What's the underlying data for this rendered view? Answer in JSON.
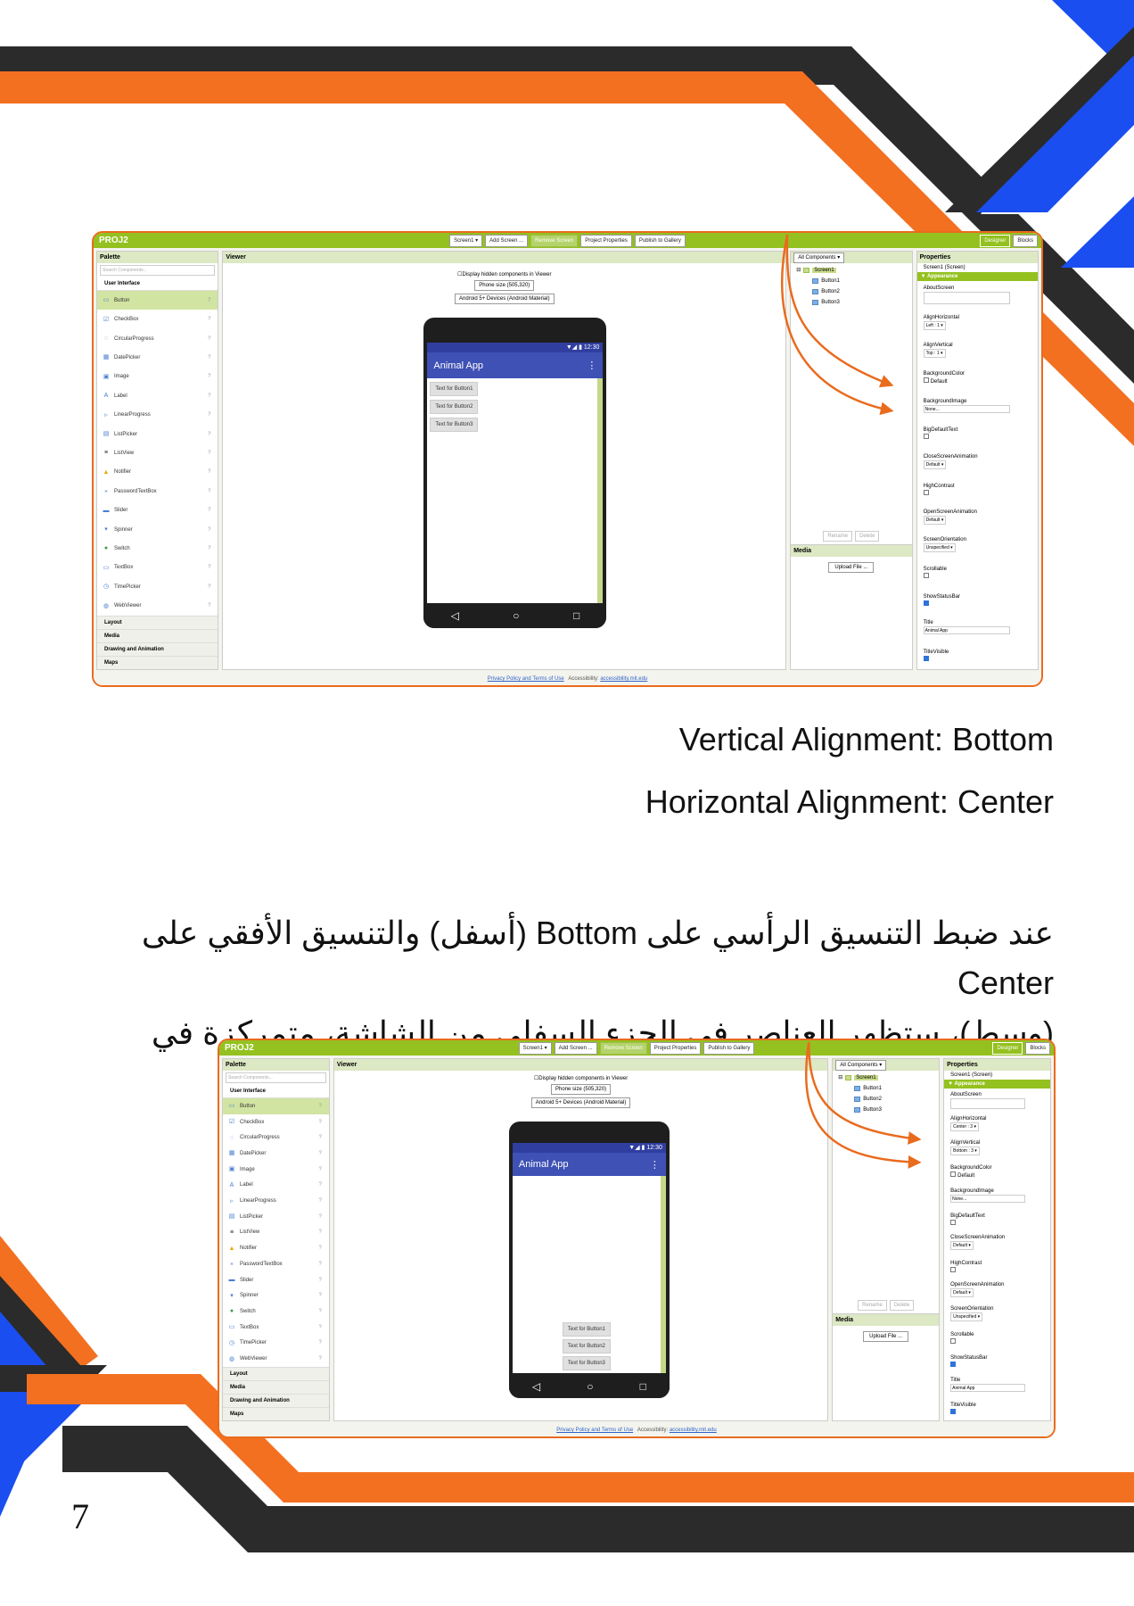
{
  "screenshots": [
    {
      "project": "PROJ2",
      "toolbar": {
        "screen": "Screen1 ▾",
        "add": "Add Screen ...",
        "remove": "Remove Screen",
        "props": "Project Properties",
        "publish": "Publish to Gallery",
        "designer": "Designer",
        "blocks": "Blocks"
      },
      "palette": {
        "title": "Palette",
        "search": "Search Components...",
        "section": "User Interface",
        "items": [
          "Button",
          "CheckBox",
          "CircularProgress",
          "DatePicker",
          "Image",
          "Label",
          "LinearProgress",
          "ListPicker",
          "ListView",
          "Notifier",
          "PasswordTextBox",
          "Slider",
          "Spinner",
          "Switch",
          "TextBox",
          "TimePicker",
          "WebViewer"
        ],
        "categories": [
          "Layout",
          "Media",
          "Drawing and Animation",
          "Maps"
        ]
      },
      "viewer": {
        "title": "Viewer",
        "checkbox": "Display hidden components in Viewer",
        "size": "Phone size (505,320)",
        "theme": "Android 5+ Devices (Android Material)"
      },
      "phone": {
        "time": "12:30",
        "app_title": "Animal App",
        "buttons": [
          "Text for Button1",
          "Text for Button2",
          "Text for Button3"
        ]
      },
      "components": {
        "title": "All Components ▾",
        "screen": "Screen1",
        "items": [
          "Button1",
          "Button2",
          "Button3"
        ],
        "rename": "Rename",
        "delete": "Delete"
      },
      "media": {
        "title": "Media",
        "upload": "Upload File ..."
      },
      "properties": {
        "title": "Properties",
        "subtitle": "Screen1 (Screen)",
        "group": "▼ Appearance",
        "align_h": "Left : 1 ▾",
        "align_v": "Top : 1 ▾",
        "bg_color": "Default",
        "bg_image": "None...",
        "close_anim": "Default ▾",
        "open_anim": "Default ▾",
        "orientation": "Unspecified ▾",
        "title_value": "Animal App"
      },
      "footer": {
        "link": "Privacy Policy and Terms of Use",
        "access": "Accessibility:",
        "access_link": "accessibility.mit.edu"
      }
    },
    {
      "project": "PROJ2",
      "toolbar": {
        "screen": "Screen1 ▾",
        "add": "Add Screen ...",
        "remove": "Remove Screen",
        "props": "Project Properties",
        "publish": "Publish to Gallery",
        "designer": "Designer",
        "blocks": "Blocks"
      },
      "palette": {
        "title": "Palette",
        "search": "Search Components...",
        "section": "User Interface",
        "items": [
          "Button",
          "CheckBox",
          "CircularProgress",
          "DatePicker",
          "Image",
          "Label",
          "LinearProgress",
          "ListPicker",
          "ListView",
          "Notifier",
          "PasswordTextBox",
          "Slider",
          "Spinner",
          "Switch",
          "TextBox",
          "TimePicker",
          "WebViewer"
        ],
        "categories": [
          "Layout",
          "Media",
          "Drawing and Animation",
          "Maps"
        ]
      },
      "viewer": {
        "title": "Viewer",
        "checkbox": "Display hidden components in Viewer",
        "size": "Phone size (505,320)",
        "theme": "Android 5+ Devices (Android Material)"
      },
      "phone": {
        "time": "12:30",
        "app_title": "Animal App",
        "buttons": [
          "Text for Button1",
          "Text for Button2",
          "Text for Button3"
        ]
      },
      "components": {
        "title": "All Components ▾",
        "screen": "Screen1",
        "items": [
          "Button1",
          "Button2",
          "Button3"
        ],
        "rename": "Rename",
        "delete": "Delete"
      },
      "media": {
        "title": "Media",
        "upload": "Upload File ..."
      },
      "properties": {
        "title": "Properties",
        "subtitle": "Screen1 (Screen)",
        "group": "▼ Appearance",
        "align_h": "Center : 3 ▾",
        "align_v": "Bottom : 3 ▾",
        "bg_color": "Default",
        "bg_image": "None...",
        "close_anim": "Default ▾",
        "open_anim": "Default ▾",
        "orientation": "Unspecified ▾",
        "title_value": "Animal App"
      },
      "footer": {
        "link": "Privacy Policy and Terms of Use",
        "access": "Accessibility:",
        "access_link": "accessibility.mit.edu"
      }
    }
  ],
  "prop_labels": {
    "about": "AboutScreen",
    "align_h": "AlignHorizontal",
    "align_v": "AlignVertical",
    "bg_color": "BackgroundColor",
    "bg_image": "BackgroundImage",
    "big_text": "BigDefaultText",
    "close_anim": "CloseScreenAnimation",
    "high_contrast": "HighContrast",
    "open_anim": "OpenScreenAnimation",
    "orientation": "ScreenOrientation",
    "scrollable": "Scrollable",
    "status_bar": "ShowStatusBar",
    "title": "Title",
    "title_visible": "TitleVisible"
  },
  "text": {
    "vertical": "Vertical Alignment: Bottom",
    "horizontal": "Horizontal Alignment: Center",
    "arabic_line1": "عند ضبط التنسيق الرأسي على Bottom (أسفل) والتنسيق الأفقي على Center",
    "arabic_line2": "(وسط)، ستظهر العناصر في الجزء السفلي من الشاشة، متمركزة في الوسط."
  },
  "page_number": "7",
  "colors": {
    "orange": "#f37021",
    "dark": "#2b2b2b",
    "blue": "#1a4ef0",
    "green": "#94c11f",
    "annotation": "#e96b1e"
  }
}
